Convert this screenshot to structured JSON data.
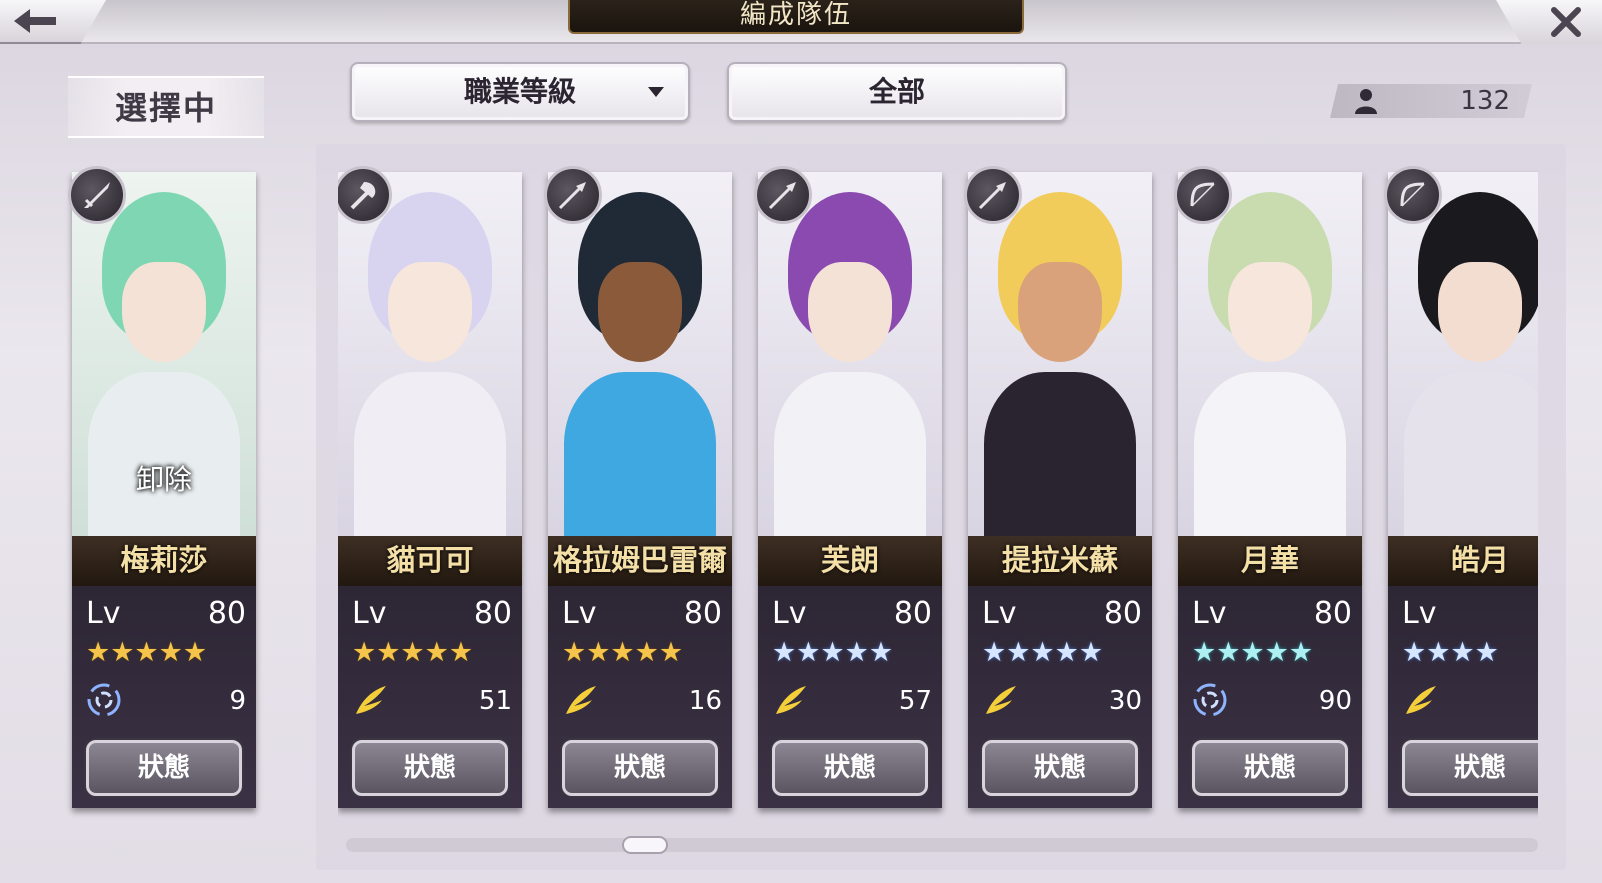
{
  "header": {
    "title": "編成隊伍"
  },
  "selected": {
    "label": "選擇中",
    "unload_label": "卸除",
    "card": {
      "name": "梅莉莎",
      "lv_label": "Lv",
      "level": "80",
      "stars": "★★★★★",
      "star_color": "gold",
      "weapon_icon": "sword-icon",
      "element_icon": "whirlwind-icon",
      "element_value": "9",
      "status_label": "狀態",
      "hair_color": "#7fd6b2",
      "body_color": "#e8eef0"
    }
  },
  "filters": {
    "sort_label": "職業等級",
    "group_label": "全部"
  },
  "count": {
    "value": "132",
    "icon": "person-icon"
  },
  "cards": [
    {
      "name": "貓可可",
      "lv_label": "Lv",
      "level": "80",
      "stars": "★★★★★",
      "star_color": "gold",
      "weapon_icon": "axe-icon",
      "element_icon": "wing-icon",
      "element_value": "51",
      "status_label": "狀態",
      "hair_color": "#d8d4f0",
      "body_color": "#f0eef4"
    },
    {
      "name": "格拉姆巴雷爾",
      "lv_label": "Lv",
      "level": "80",
      "stars": "★★★★★",
      "star_color": "gold",
      "weapon_icon": "spear-icon",
      "element_icon": "wing-icon",
      "element_value": "16",
      "status_label": "狀態",
      "hair_color": "#1f2a36",
      "body_color": "#3fa8e0"
    },
    {
      "name": "芙朗",
      "lv_label": "Lv",
      "level": "80",
      "stars": "★★★★★",
      "star_color": "silver",
      "weapon_icon": "spear-icon",
      "element_icon": "wing-icon",
      "element_value": "57",
      "status_label": "狀態",
      "hair_color": "#8a4ab0",
      "body_color": "#f2f2f6"
    },
    {
      "name": "提拉米蘇",
      "lv_label": "Lv",
      "level": "80",
      "stars": "★★★★★",
      "star_color": "silver",
      "weapon_icon": "spear-icon",
      "element_icon": "wing-icon",
      "element_value": "30",
      "status_label": "狀態",
      "hair_color": "#f2cc5a",
      "body_color": "#2a2430"
    },
    {
      "name": "月華",
      "lv_label": "Lv",
      "level": "80",
      "stars": "★★★★★",
      "star_color": "cyan",
      "weapon_icon": "bow-icon",
      "element_icon": "whirlwind-icon",
      "element_value": "90",
      "status_label": "狀態",
      "hair_color": "#c8dcb0",
      "body_color": "#f4f4f8"
    },
    {
      "name": "皓月",
      "lv_label": "Lv",
      "level": "",
      "stars": "★★★★",
      "star_color": "silver",
      "weapon_icon": "bow-icon",
      "element_icon": "wing-icon",
      "element_value": "",
      "status_label": "狀態",
      "hair_color": "#1a1a1e",
      "body_color": "#e6e2ec"
    }
  ]
}
